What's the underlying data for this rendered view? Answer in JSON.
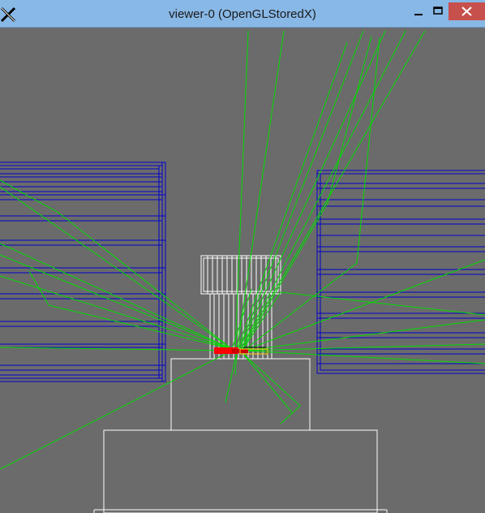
{
  "window": {
    "title": "viewer-0 (OpenGLStoredX)",
    "icon": "x-app-icon",
    "controls": [
      "minimize-icon",
      "maximize-icon",
      "close-icon"
    ]
  },
  "scene": {
    "background_color": "#6b6b6b",
    "detector_color": "#0000cc",
    "geometry_color": "#ffffff",
    "track_color": "#00dd00",
    "hit_color": "#ff0000"
  }
}
